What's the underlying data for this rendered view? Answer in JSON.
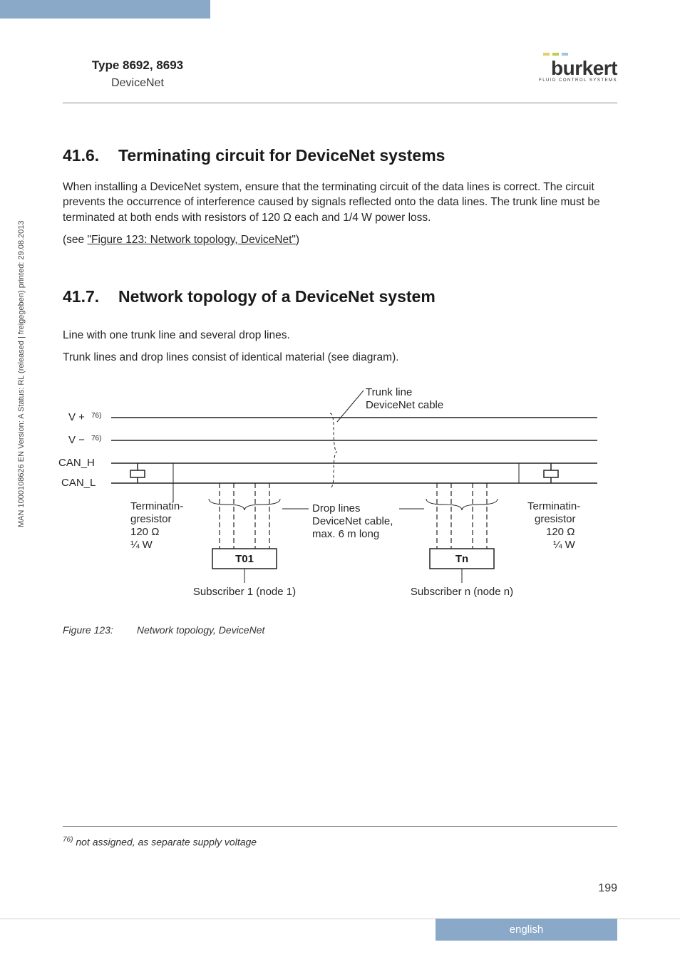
{
  "header": {
    "title": "Type 8692, 8693",
    "subtitle": "DeviceNet",
    "logo_text": "burkert",
    "logo_tag": "FLUID CONTROL SYSTEMS"
  },
  "side_text": "MAN 1000108626 EN Version: A Status: RL (released | freigegeben) printed: 29.08.2013",
  "section1": {
    "num": "41.6.",
    "title": "Terminating circuit for DeviceNet systems",
    "p1": "When installing a DeviceNet system, ensure that the terminating circuit of the data lines is correct. The circuit prevents the occurrence of interference caused by signals reflected onto the data lines. The trunk line must be terminated at both ends with resistors of 120 Ω each and 1/4 W power loss.",
    "p2_prefix": "(see ",
    "p2_link": "\"Figure 123: Network topology, DeviceNet\"",
    "p2_suffix": ")"
  },
  "section2": {
    "num": "41.7.",
    "title": "Network topology of a DeviceNet system",
    "p1": "Line with one trunk line and several drop lines.",
    "p2": "Trunk lines and drop lines consist of identical material (see diagram)."
  },
  "diagram": {
    "trunk_l1": "Trunk line",
    "trunk_l2": "DeviceNet cable",
    "v_plus": "V +",
    "v_minus": "V −",
    "can_h": "CAN_H",
    "can_l": "CAN_L",
    "term_l1": "Terminatin-",
    "term_l2": "gresistor",
    "term_l3": "120 Ω",
    "term_l4": "¼ W",
    "drop_l1": "Drop lines",
    "drop_l2": "DeviceNet cable,",
    "drop_l3": "max. 6 m long",
    "t01": "T01",
    "tn": "Tn",
    "sub1": "Subscriber 1 (node 1)",
    "subn": "Subscriber n (node n)",
    "fn_ref": "76)"
  },
  "figure": {
    "label": "Figure 123:",
    "caption": "Network topology, DeviceNet"
  },
  "footnote": {
    "ref": "76)",
    "text": " not assigned, as separate supply voltage"
  },
  "page_number": "199",
  "language": "english"
}
